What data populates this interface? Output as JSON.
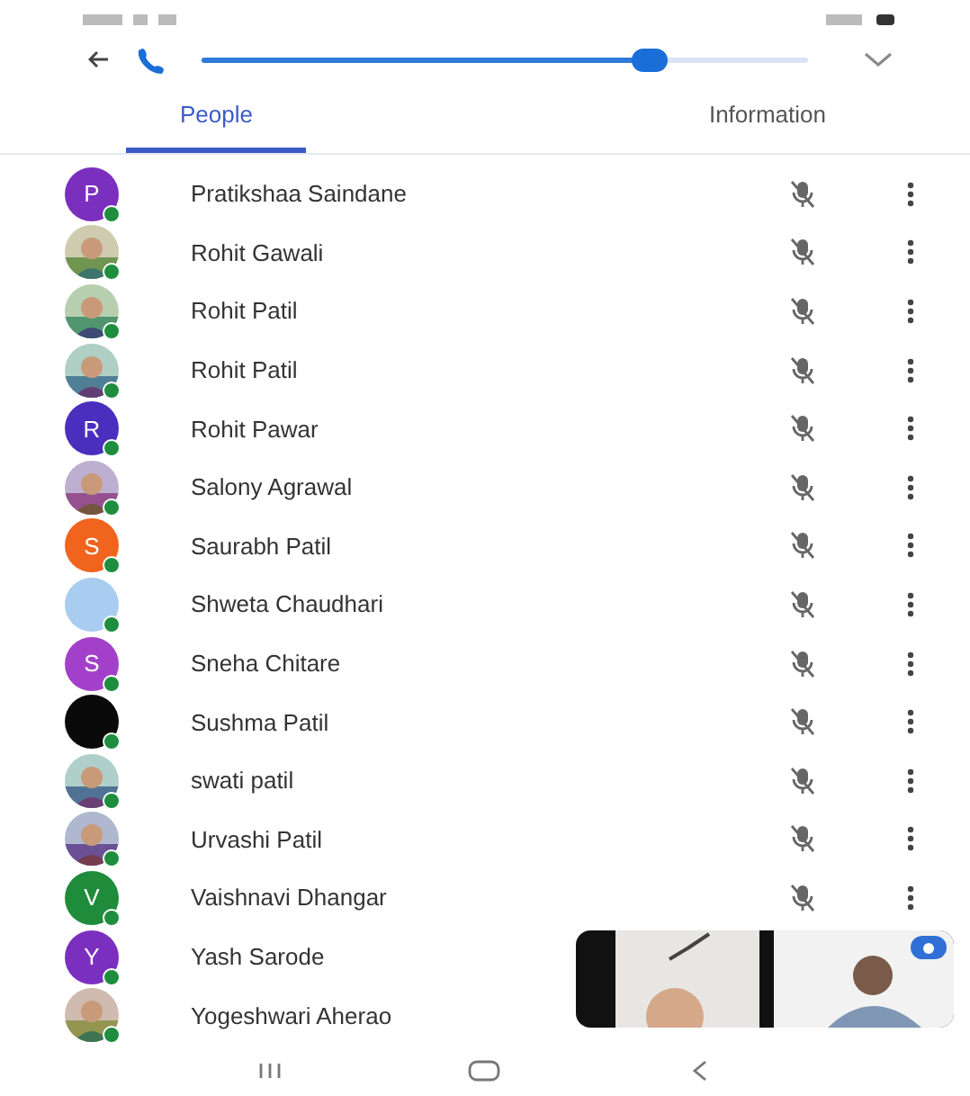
{
  "call_bar": {
    "level": 0.74
  },
  "tabs": [
    {
      "label": "People",
      "selected": true
    },
    {
      "label": "Information",
      "selected": false
    }
  ],
  "participants": [
    {
      "name": "Pratikshaa Saindane",
      "avatar": {
        "kind": "letter",
        "letter": "P",
        "color": "#7b2fbf"
      }
    },
    {
      "name": "Rohit Gawali"
    },
    {
      "name": "Rohit Patil"
    },
    {
      "name": "Rohit Patil"
    },
    {
      "name": "Rohit Pawar",
      "avatar": {
        "kind": "letter",
        "letter": "R",
        "color": "#4a2fbf"
      }
    },
    {
      "name": "Salony Agrawal"
    },
    {
      "name": "Saurabh Patil",
      "avatar": {
        "kind": "letter",
        "letter": "S",
        "color": "#f0641e"
      }
    },
    {
      "name": "Shweta Chaudhari",
      "avatar": {
        "kind": "plain",
        "color": "#a9cdf0"
      }
    },
    {
      "name": "Sneha Chitare",
      "avatar": {
        "kind": "letter",
        "letter": "S",
        "color": "#a340c9"
      }
    },
    {
      "name": "Sushma Patil",
      "avatar": {
        "kind": "plain",
        "color": "#0a0a0a"
      }
    },
    {
      "name": "swati patil"
    },
    {
      "name": "Urvashi Patil"
    },
    {
      "name": "Vaishnavi Dhangar",
      "avatar": {
        "kind": "letter",
        "letter": "V",
        "color": "#1e8c3a"
      }
    },
    {
      "name": "Yash Sarode",
      "avatar": {
        "kind": "letter",
        "letter": "Y",
        "color": "#7b2fbf"
      }
    },
    {
      "name": "Yogeshwari Aherao"
    }
  ]
}
